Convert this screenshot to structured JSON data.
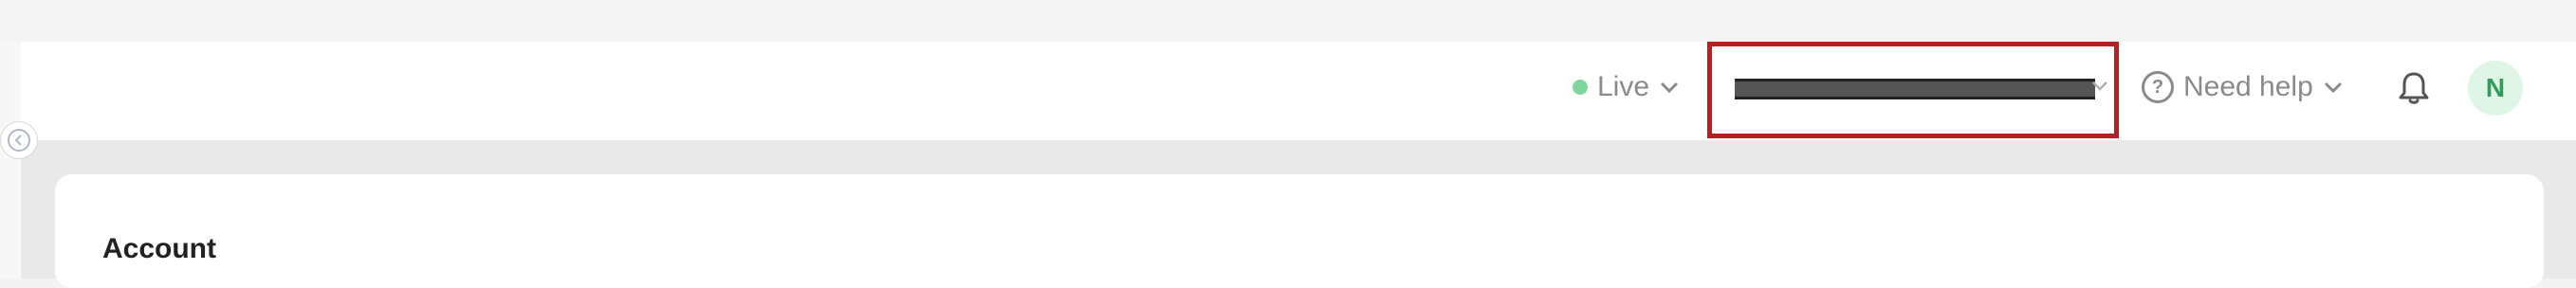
{
  "header": {
    "live_label": "Live",
    "environment_selector": {
      "label": "........................ (redacted)",
      "redacted": true
    },
    "help_label": "Need help",
    "help_icon": "question-circle-icon",
    "notifications_icon": "bell-icon",
    "avatar_initial": "N"
  },
  "sidebar": {
    "collapse_icon": "chevron-left-circle-icon"
  },
  "main": {
    "card_title": "Account"
  },
  "colors": {
    "live_dot": "#7fd59b",
    "highlight_border": "#b22222",
    "avatar_bg": "#dff5e6",
    "avatar_text": "#2e9d57"
  }
}
